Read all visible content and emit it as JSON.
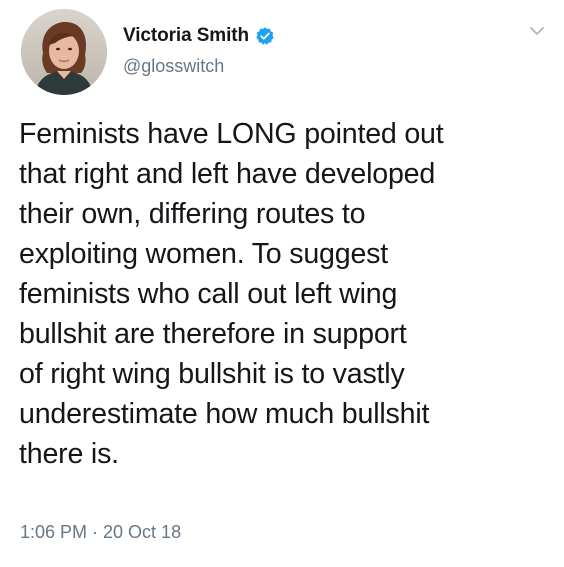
{
  "user": {
    "display_name": "Victoria Smith",
    "handle": "@glosswitch",
    "verified_icon": "verified-badge-icon",
    "verified_color": "#1da1f2"
  },
  "tweet": {
    "text": "Feminists have LONG pointed out\nthat right and left have developed\ntheir own, differing routes to\nexploiting women. To suggest\nfeminists who call out left wing\nbullshit are therefore in support\nof right wing bullshit is to vastly\nunderestimate how much bullshit\nthere is.",
    "timestamp": "1:06 PM · 20 Oct 18"
  },
  "menu": {
    "icon": "chevron-down-icon"
  },
  "colors": {
    "text": "#14171a",
    "secondary": "#657786",
    "accent": "#1da1f2",
    "background": "#ffffff"
  }
}
